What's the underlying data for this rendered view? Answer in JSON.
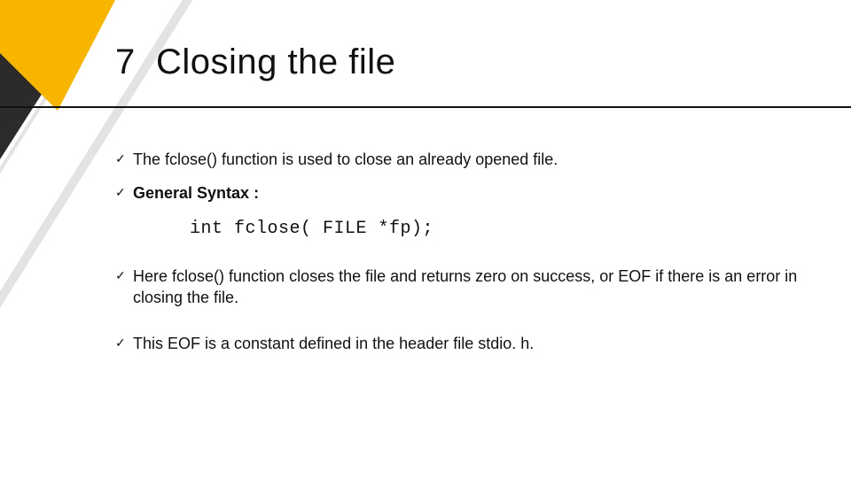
{
  "title": "7. Closing the file",
  "bullets": {
    "b1": "The fclose() function is used to close an already opened file.",
    "b2": "General Syntax :",
    "code": "int fclose( FILE *fp);",
    "b3": "Here fclose() function closes the file and returns zero on success, or EOF if there is an error in closing the file.",
    "b4": " This EOF is a constant defined in the header file stdio. h."
  },
  "check": "✓"
}
